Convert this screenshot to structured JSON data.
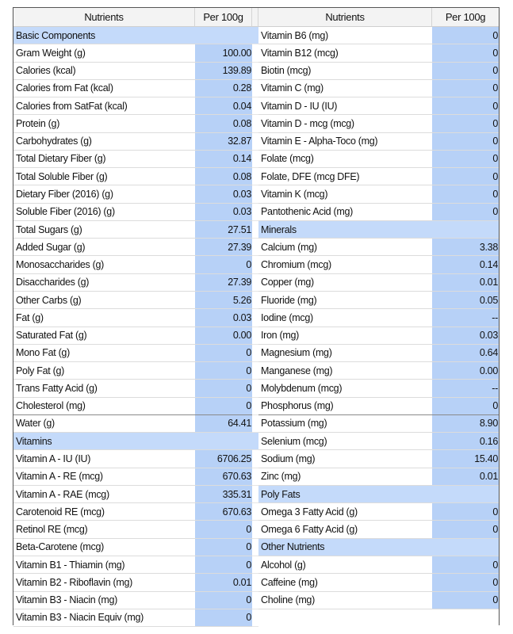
{
  "headers": {
    "left_name": "Nutrients",
    "left_value": "Per 100g",
    "right_name": "Nutrients",
    "right_value": "Per 100g"
  },
  "left_rows": [
    {
      "name": "Basic Components",
      "value": "",
      "section": true
    },
    {
      "name": "Gram Weight (g)",
      "value": "100.00"
    },
    {
      "name": "Calories (kcal)",
      "value": "139.89"
    },
    {
      "name": "Calories from Fat (kcal)",
      "value": "0.28"
    },
    {
      "name": "Calories from SatFat (kcal)",
      "value": "0.04"
    },
    {
      "name": "Protein (g)",
      "value": "0.08"
    },
    {
      "name": "Carbohydrates (g)",
      "value": "32.87"
    },
    {
      "name": "Total Dietary Fiber (g)",
      "value": "0.14"
    },
    {
      "name": "Total Soluble Fiber (g)",
      "value": "0.08"
    },
    {
      "name": "Dietary Fiber (2016) (g)",
      "value": "0.03"
    },
    {
      "name": "Soluble Fiber (2016) (g)",
      "value": "0.03"
    },
    {
      "name": "Total Sugars (g)",
      "value": "27.51"
    },
    {
      "name": "Added Sugar (g)",
      "value": "27.39"
    },
    {
      "name": "Monosaccharides (g)",
      "value": "0"
    },
    {
      "name": "Disaccharides (g)",
      "value": "27.39"
    },
    {
      "name": "Other Carbs (g)",
      "value": "5.26"
    },
    {
      "name": "Fat (g)",
      "value": "0.03"
    },
    {
      "name": "Saturated Fat (g)",
      "value": "0.00"
    },
    {
      "name": "Mono Fat (g)",
      "value": "0"
    },
    {
      "name": "Poly Fat (g)",
      "value": "0"
    },
    {
      "name": "Trans Fatty Acid (g)",
      "value": "0"
    },
    {
      "name": "Cholesterol (mg)",
      "value": "0"
    },
    {
      "name": "Water (g)",
      "value": "64.41"
    },
    {
      "name": "Vitamins",
      "value": "",
      "section": true
    },
    {
      "name": "Vitamin A - IU (IU)",
      "value": "6706.25"
    },
    {
      "name": "Vitamin A - RE (mcg)",
      "value": "670.63"
    },
    {
      "name": "Vitamin A - RAE (mcg)",
      "value": "335.31"
    },
    {
      "name": "Carotenoid RE (mcg)",
      "value": "670.63"
    },
    {
      "name": "Retinol RE (mcg)",
      "value": "0"
    },
    {
      "name": "Beta-Carotene (mcg)",
      "value": "0"
    },
    {
      "name": "Vitamin B1 - Thiamin (mg)",
      "value": "0"
    },
    {
      "name": "Vitamin B2 - Riboflavin (mg)",
      "value": "0.01"
    },
    {
      "name": "Vitamin B3 - Niacin (mg)",
      "value": "0"
    },
    {
      "name": "Vitamin B3 - Niacin Equiv (mg)",
      "value": "0"
    }
  ],
  "right_rows": [
    {
      "name": "Vitamin B6 (mg)",
      "value": "0"
    },
    {
      "name": "Vitamin B12 (mcg)",
      "value": "0"
    },
    {
      "name": "Biotin (mcg)",
      "value": "0"
    },
    {
      "name": "Vitamin C (mg)",
      "value": "0"
    },
    {
      "name": "Vitamin D - IU (IU)",
      "value": "0"
    },
    {
      "name": "Vitamin D - mcg (mcg)",
      "value": "0"
    },
    {
      "name": "Vitamin E - Alpha-Toco (mg)",
      "value": "0"
    },
    {
      "name": "Folate (mcg)",
      "value": "0"
    },
    {
      "name": "Folate, DFE (mcg DFE)",
      "value": "0"
    },
    {
      "name": "Vitamin K (mcg)",
      "value": "0"
    },
    {
      "name": "Pantothenic Acid (mg)",
      "value": "0"
    },
    {
      "name": "Minerals",
      "value": "",
      "section": true
    },
    {
      "name": "Calcium (mg)",
      "value": "3.38"
    },
    {
      "name": "Chromium (mcg)",
      "value": "0.14"
    },
    {
      "name": "Copper (mg)",
      "value": "0.01"
    },
    {
      "name": "Fluoride (mg)",
      "value": "0.05"
    },
    {
      "name": "Iodine (mcg)",
      "value": "--"
    },
    {
      "name": "Iron (mg)",
      "value": "0.03"
    },
    {
      "name": "Magnesium (mg)",
      "value": "0.64"
    },
    {
      "name": "Manganese (mg)",
      "value": "0.00"
    },
    {
      "name": "Molybdenum (mcg)",
      "value": "--"
    },
    {
      "name": "Phosphorus (mg)",
      "value": "0"
    },
    {
      "name": "Potassium (mg)",
      "value": "8.90"
    },
    {
      "name": "Selenium (mcg)",
      "value": "0.16"
    },
    {
      "name": "Sodium (mg)",
      "value": "15.40"
    },
    {
      "name": "Zinc (mg)",
      "value": "0.01"
    },
    {
      "name": "Poly Fats",
      "value": "",
      "section": true
    },
    {
      "name": "Omega 3 Fatty Acid (g)",
      "value": "0"
    },
    {
      "name": "Omega 6 Fatty Acid (g)",
      "value": "0"
    },
    {
      "name": "Other Nutrients",
      "value": "",
      "section": true
    },
    {
      "name": "Alcohol (g)",
      "value": "0"
    },
    {
      "name": "Caffeine (mg)",
      "value": "0"
    },
    {
      "name": "Choline (mg)",
      "value": "0"
    },
    {
      "name": "",
      "value": "",
      "empty": true
    }
  ]
}
